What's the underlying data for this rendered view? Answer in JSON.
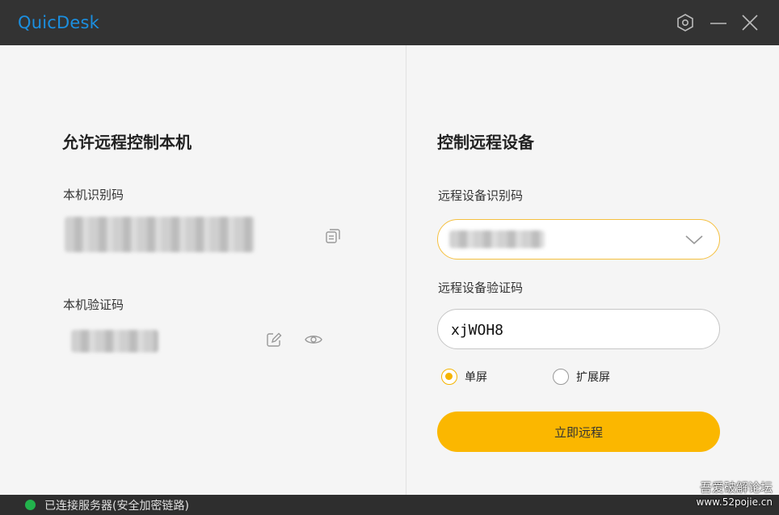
{
  "app": {
    "title": "QuicDesk"
  },
  "window_controls": {
    "settings_icon": "hexagon-settings-icon",
    "minimize_icon": "minimize-icon",
    "close_icon": "close-icon"
  },
  "left_panel": {
    "title": "允许远程控制本机",
    "device_id_label": "本机识别码",
    "verification_label": "本机验证码",
    "copy_icon": "copy-icon",
    "edit_icon": "edit-icon",
    "eye_icon": "eye-icon"
  },
  "right_panel": {
    "title": "控制远程设备",
    "remote_id_label": "远程设备识别码",
    "remote_code_label": "远程设备验证码",
    "remote_code_value": "xjWOH8",
    "mode_options": [
      "单屏",
      "扩展屏"
    ],
    "selected_mode": "单屏",
    "connect_button": "立即远程"
  },
  "status": {
    "text": "已连接服务器(安全加密链路)",
    "color": "#22b24c"
  },
  "watermark": {
    "line1": "吾爱破解论坛",
    "line2": "www.52pojie.cn"
  },
  "colors": {
    "accent": "#fbb700",
    "title_blue": "#1b8fe0",
    "titlebar": "#333333"
  }
}
